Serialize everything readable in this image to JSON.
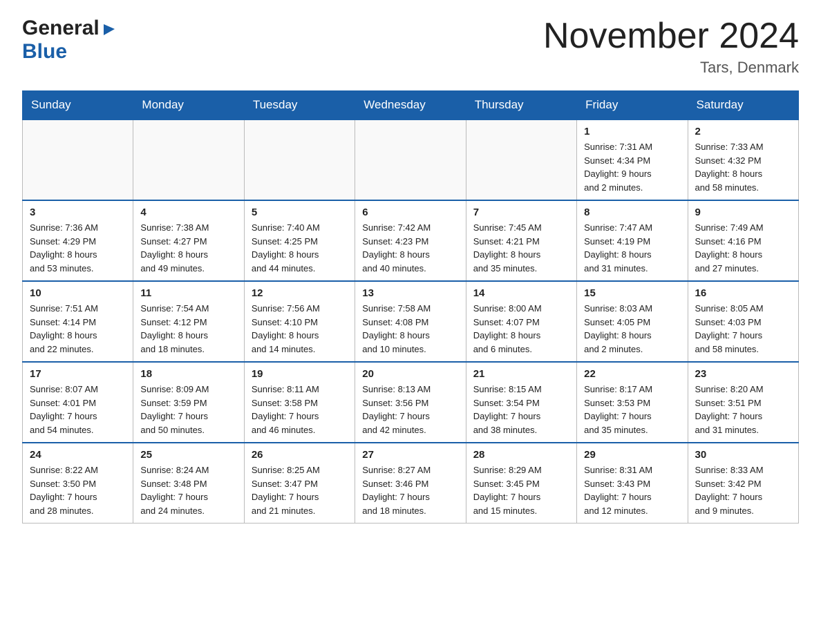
{
  "header": {
    "logo_general": "General",
    "logo_blue": "Blue",
    "month_title": "November 2024",
    "location": "Tars, Denmark"
  },
  "days_of_week": [
    "Sunday",
    "Monday",
    "Tuesday",
    "Wednesday",
    "Thursday",
    "Friday",
    "Saturday"
  ],
  "weeks": [
    [
      {
        "day": "",
        "info": ""
      },
      {
        "day": "",
        "info": ""
      },
      {
        "day": "",
        "info": ""
      },
      {
        "day": "",
        "info": ""
      },
      {
        "day": "",
        "info": ""
      },
      {
        "day": "1",
        "info": "Sunrise: 7:31 AM\nSunset: 4:34 PM\nDaylight: 9 hours\nand 2 minutes."
      },
      {
        "day": "2",
        "info": "Sunrise: 7:33 AM\nSunset: 4:32 PM\nDaylight: 8 hours\nand 58 minutes."
      }
    ],
    [
      {
        "day": "3",
        "info": "Sunrise: 7:36 AM\nSunset: 4:29 PM\nDaylight: 8 hours\nand 53 minutes."
      },
      {
        "day": "4",
        "info": "Sunrise: 7:38 AM\nSunset: 4:27 PM\nDaylight: 8 hours\nand 49 minutes."
      },
      {
        "day": "5",
        "info": "Sunrise: 7:40 AM\nSunset: 4:25 PM\nDaylight: 8 hours\nand 44 minutes."
      },
      {
        "day": "6",
        "info": "Sunrise: 7:42 AM\nSunset: 4:23 PM\nDaylight: 8 hours\nand 40 minutes."
      },
      {
        "day": "7",
        "info": "Sunrise: 7:45 AM\nSunset: 4:21 PM\nDaylight: 8 hours\nand 35 minutes."
      },
      {
        "day": "8",
        "info": "Sunrise: 7:47 AM\nSunset: 4:19 PM\nDaylight: 8 hours\nand 31 minutes."
      },
      {
        "day": "9",
        "info": "Sunrise: 7:49 AM\nSunset: 4:16 PM\nDaylight: 8 hours\nand 27 minutes."
      }
    ],
    [
      {
        "day": "10",
        "info": "Sunrise: 7:51 AM\nSunset: 4:14 PM\nDaylight: 8 hours\nand 22 minutes."
      },
      {
        "day": "11",
        "info": "Sunrise: 7:54 AM\nSunset: 4:12 PM\nDaylight: 8 hours\nand 18 minutes."
      },
      {
        "day": "12",
        "info": "Sunrise: 7:56 AM\nSunset: 4:10 PM\nDaylight: 8 hours\nand 14 minutes."
      },
      {
        "day": "13",
        "info": "Sunrise: 7:58 AM\nSunset: 4:08 PM\nDaylight: 8 hours\nand 10 minutes."
      },
      {
        "day": "14",
        "info": "Sunrise: 8:00 AM\nSunset: 4:07 PM\nDaylight: 8 hours\nand 6 minutes."
      },
      {
        "day": "15",
        "info": "Sunrise: 8:03 AM\nSunset: 4:05 PM\nDaylight: 8 hours\nand 2 minutes."
      },
      {
        "day": "16",
        "info": "Sunrise: 8:05 AM\nSunset: 4:03 PM\nDaylight: 7 hours\nand 58 minutes."
      }
    ],
    [
      {
        "day": "17",
        "info": "Sunrise: 8:07 AM\nSunset: 4:01 PM\nDaylight: 7 hours\nand 54 minutes."
      },
      {
        "day": "18",
        "info": "Sunrise: 8:09 AM\nSunset: 3:59 PM\nDaylight: 7 hours\nand 50 minutes."
      },
      {
        "day": "19",
        "info": "Sunrise: 8:11 AM\nSunset: 3:58 PM\nDaylight: 7 hours\nand 46 minutes."
      },
      {
        "day": "20",
        "info": "Sunrise: 8:13 AM\nSunset: 3:56 PM\nDaylight: 7 hours\nand 42 minutes."
      },
      {
        "day": "21",
        "info": "Sunrise: 8:15 AM\nSunset: 3:54 PM\nDaylight: 7 hours\nand 38 minutes."
      },
      {
        "day": "22",
        "info": "Sunrise: 8:17 AM\nSunset: 3:53 PM\nDaylight: 7 hours\nand 35 minutes."
      },
      {
        "day": "23",
        "info": "Sunrise: 8:20 AM\nSunset: 3:51 PM\nDaylight: 7 hours\nand 31 minutes."
      }
    ],
    [
      {
        "day": "24",
        "info": "Sunrise: 8:22 AM\nSunset: 3:50 PM\nDaylight: 7 hours\nand 28 minutes."
      },
      {
        "day": "25",
        "info": "Sunrise: 8:24 AM\nSunset: 3:48 PM\nDaylight: 7 hours\nand 24 minutes."
      },
      {
        "day": "26",
        "info": "Sunrise: 8:25 AM\nSunset: 3:47 PM\nDaylight: 7 hours\nand 21 minutes."
      },
      {
        "day": "27",
        "info": "Sunrise: 8:27 AM\nSunset: 3:46 PM\nDaylight: 7 hours\nand 18 minutes."
      },
      {
        "day": "28",
        "info": "Sunrise: 8:29 AM\nSunset: 3:45 PM\nDaylight: 7 hours\nand 15 minutes."
      },
      {
        "day": "29",
        "info": "Sunrise: 8:31 AM\nSunset: 3:43 PM\nDaylight: 7 hours\nand 12 minutes."
      },
      {
        "day": "30",
        "info": "Sunrise: 8:33 AM\nSunset: 3:42 PM\nDaylight: 7 hours\nand 9 minutes."
      }
    ]
  ]
}
